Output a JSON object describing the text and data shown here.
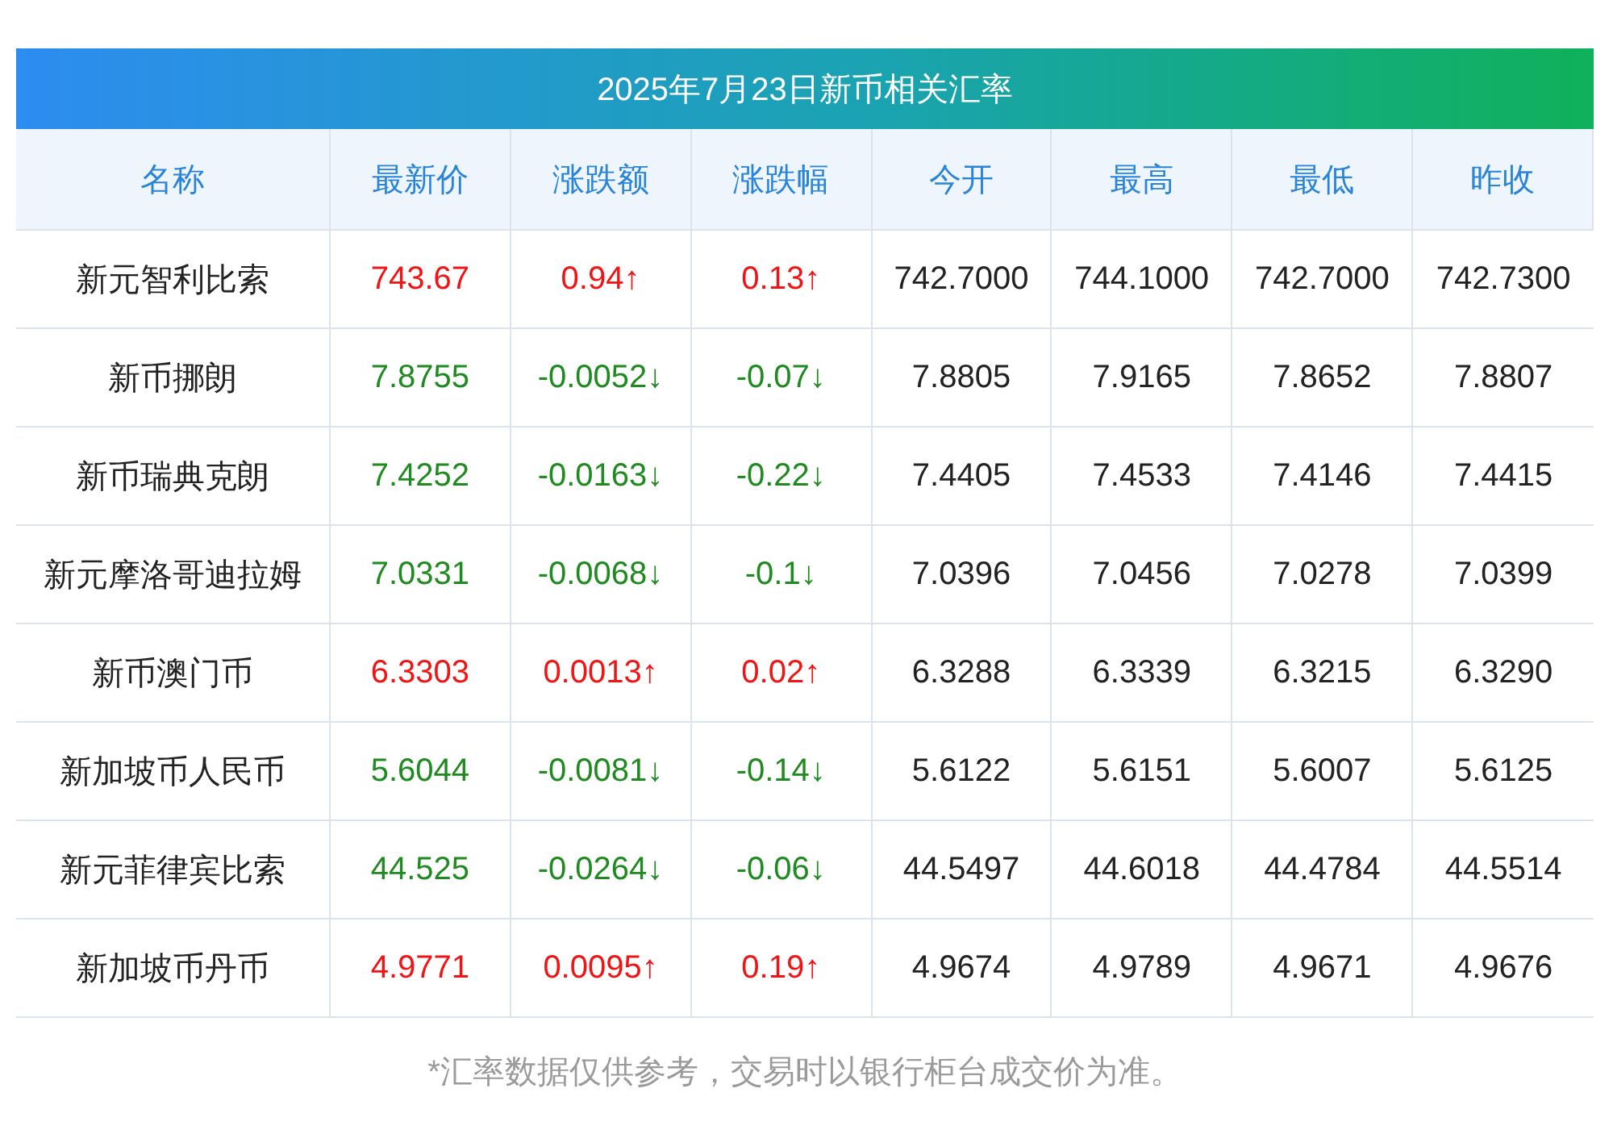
{
  "title": "2025年7月23日新币相关汇率",
  "columns": [
    "名称",
    "最新价",
    "涨跌额",
    "涨跌幅",
    "今开",
    "最高",
    "最低",
    "昨收"
  ],
  "rows": [
    {
      "color": "#f01414",
      "cells": [
        "新元智利比索",
        "743.67",
        "0.94↑",
        "0.13↑",
        "742.7000",
        "744.1000",
        "742.7000",
        "742.7300"
      ]
    },
    {
      "color": "#1f8a1f",
      "cells": [
        "新币挪朗",
        "7.8755",
        "-0.0052↓",
        "-0.07↓",
        "7.8805",
        "7.9165",
        "7.8652",
        "7.8807"
      ]
    },
    {
      "color": "#1f8a1f",
      "cells": [
        "新币瑞典克朗",
        "7.4252",
        "-0.0163↓",
        "-0.22↓",
        "7.4405",
        "7.4533",
        "7.4146",
        "7.4415"
      ]
    },
    {
      "color": "#1f8a1f",
      "cells": [
        "新元摩洛哥迪拉姆",
        "7.0331",
        "-0.0068↓",
        "-0.1↓",
        "7.0396",
        "7.0456",
        "7.0278",
        "7.0399"
      ]
    },
    {
      "color": "#f01414",
      "cells": [
        "新币澳门币",
        "6.3303",
        "0.0013↑",
        "0.02↑",
        "6.3288",
        "6.3339",
        "6.3215",
        "6.3290"
      ]
    },
    {
      "color": "#1f8a1f",
      "cells": [
        "新加坡币人民币",
        "5.6044",
        "-0.0081↓",
        "-0.14↓",
        "5.6122",
        "5.6151",
        "5.6007",
        "5.6125"
      ]
    },
    {
      "color": "#1f8a1f",
      "cells": [
        "新元菲律宾比索",
        "44.525",
        "-0.0264↓",
        "-0.06↓",
        "44.5497",
        "44.6018",
        "44.4784",
        "44.5514"
      ]
    },
    {
      "color": "#f01414",
      "cells": [
        "新加坡币丹币",
        "4.9771",
        "0.0095↑",
        "0.19↑",
        "4.9674",
        "4.9789",
        "4.9671",
        "4.9676"
      ]
    }
  ],
  "footnote": "*汇率数据仅供参考，交易时以银行柜台成交价为准。"
}
